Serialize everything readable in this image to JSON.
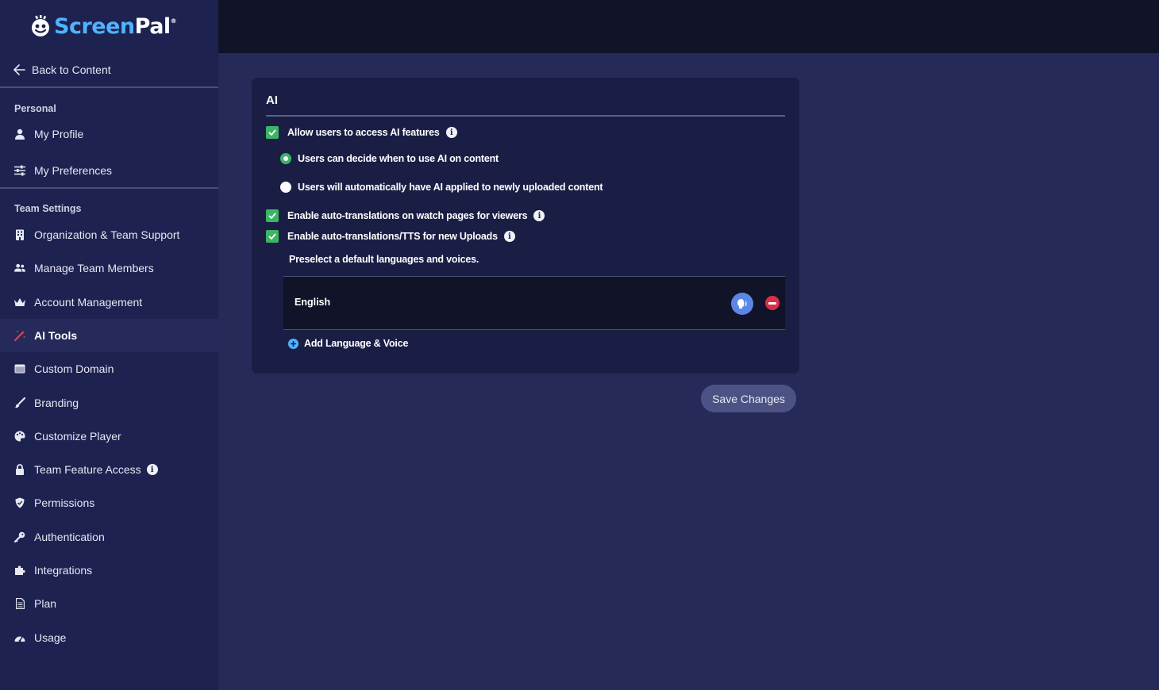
{
  "brand": {
    "name_part1": "Screen",
    "name_part2": "Pal",
    "mark": "®"
  },
  "sidebar": {
    "back_label": "Back to Content",
    "personal_title": "Personal",
    "personal_items": [
      {
        "label": "My Profile",
        "icon": "user-icon"
      },
      {
        "label": "My Preferences",
        "icon": "sliders-icon"
      }
    ],
    "team_title": "Team Settings",
    "team_items": [
      {
        "label": "Organization & Team Support",
        "icon": "building-icon"
      },
      {
        "label": "Manage Team Members",
        "icon": "users-icon"
      },
      {
        "label": "Account Management",
        "icon": "crown-icon"
      },
      {
        "label": "AI Tools",
        "icon": "magic-wand-icon",
        "active": true
      },
      {
        "label": "Custom Domain",
        "icon": "window-icon"
      },
      {
        "label": "Branding",
        "icon": "brush-icon"
      },
      {
        "label": "Customize Player",
        "icon": "palette-icon"
      },
      {
        "label": "Team Feature Access",
        "icon": "lock-icon",
        "info": true
      },
      {
        "label": "Permissions",
        "icon": "shield-icon"
      },
      {
        "label": "Authentication",
        "icon": "key-icon"
      },
      {
        "label": "Integrations",
        "icon": "puzzle-icon"
      },
      {
        "label": "Plan",
        "icon": "document-icon"
      },
      {
        "label": "Usage",
        "icon": "gauge-icon"
      }
    ]
  },
  "card": {
    "title": "AI",
    "allow_ai": "Allow users to access AI features",
    "radio_decide": "Users can decide when to use AI on content",
    "radio_auto": "Users will automatically have AI applied to newly uploaded content",
    "auto_translate_watch": "Enable auto-translations on watch pages for viewers",
    "auto_translate_uploads": "Enable auto-translations/TTS for new Uploads",
    "preselect_hint": "Preselect a default languages and voices.",
    "language": "English",
    "add_language": "Add Language & Voice"
  },
  "save_label": "Save Changes",
  "info_glyph": "i",
  "colors": {
    "sidebar_bg": "#1d2250",
    "content_bg": "#262a58",
    "topbar_bg": "#111428",
    "card_bg": "#1a1e45",
    "checkbox_green": "#3bb565",
    "accent_blue": "#4fb3ff",
    "remove_red": "#d8304a",
    "voice_blue": "#5b86e5"
  }
}
